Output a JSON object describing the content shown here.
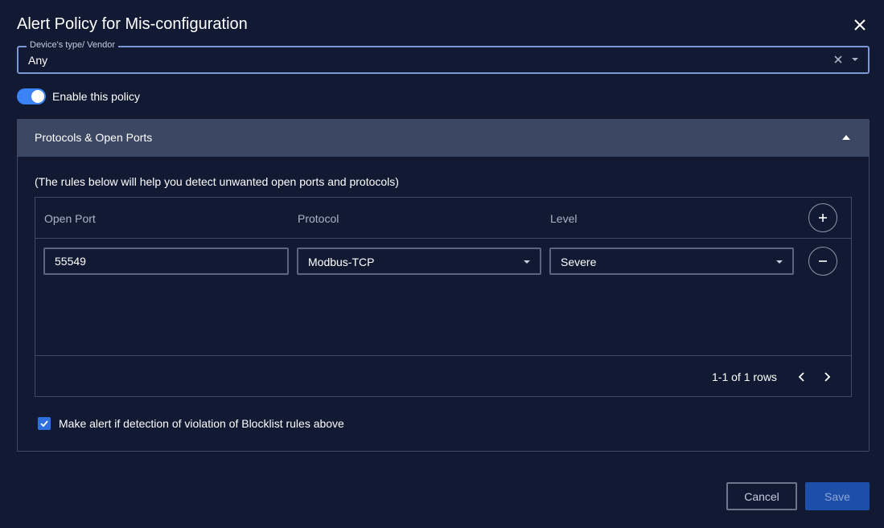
{
  "dialog": {
    "title": "Alert Policy for Mis-configuration"
  },
  "vendor": {
    "label": "Device's type/ Vendor",
    "value": "Any"
  },
  "policy": {
    "enable_label": "Enable this policy",
    "enabled": true
  },
  "panel": {
    "title": "Protocols & Open Ports",
    "description": "(The rules below will help you detect unwanted open ports and protocols)"
  },
  "table": {
    "columns": [
      "Open Port",
      "Protocol",
      "Level"
    ],
    "rows": [
      {
        "port": "55549",
        "protocol": "Modbus-TCP",
        "level": "Severe"
      }
    ],
    "pager": "1-1 of 1 rows"
  },
  "blocklist": {
    "label": "Make alert if detection of violation of Blocklist rules above",
    "checked": true
  },
  "footer": {
    "cancel_label": "Cancel",
    "save_label": "Save"
  },
  "colors": {
    "background": "#121a33",
    "accent": "#3b82f6",
    "panel_header": "#3b4763",
    "save_button": "#1e4fa8"
  },
  "icons": {
    "close": "close-icon",
    "clear": "clear-icon",
    "dropdown": "chevron-down-icon",
    "collapse": "caret-up-icon",
    "add": "plus-icon",
    "remove": "minus-icon",
    "prev": "chevron-left-icon",
    "next": "chevron-right-icon",
    "check": "check-icon"
  }
}
